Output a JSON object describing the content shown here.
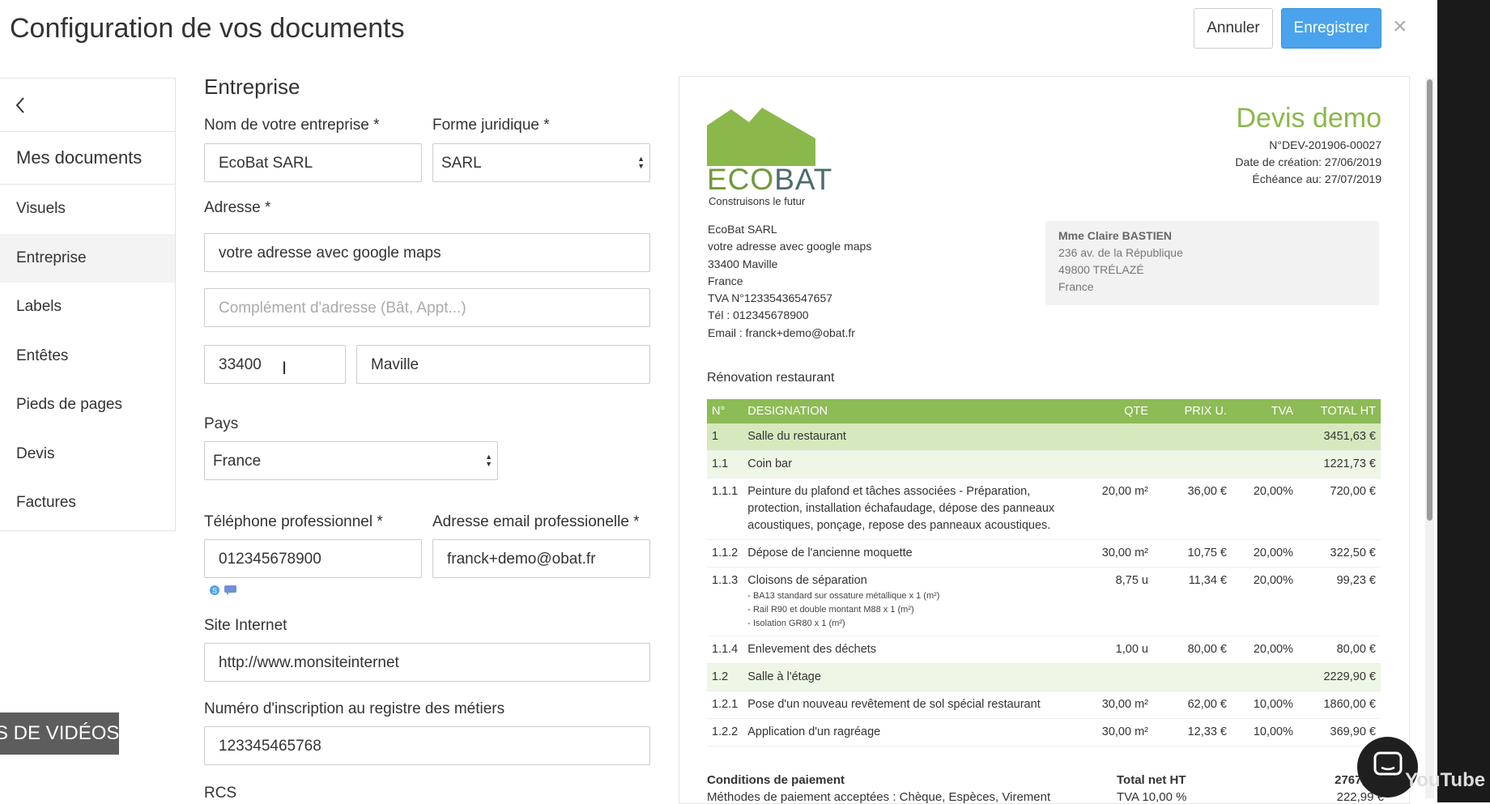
{
  "header": {
    "title": "Configuration de vos documents",
    "cancel_label": "Annuler",
    "save_label": "Enregistrer",
    "close_glyph": "×"
  },
  "sidebar": {
    "heading": "Mes documents",
    "items": [
      {
        "label": "Visuels"
      },
      {
        "label": "Entreprise"
      },
      {
        "label": "Labels"
      },
      {
        "label": "Entêtes"
      },
      {
        "label": "Pieds de pages"
      },
      {
        "label": "Devis"
      },
      {
        "label": "Factures"
      }
    ]
  },
  "form": {
    "section_title": "Entreprise",
    "company_name_label": "Nom de votre entreprise *",
    "company_name_value": "EcoBat SARL",
    "legal_form_label": "Forme juridique *",
    "legal_form_value": "SARL",
    "address_label": "Adresse *",
    "address_value": "votre adresse avec google maps",
    "address2_placeholder": "Complément d'adresse (Bât, Appt...)",
    "zip_value": "33400",
    "city_value": "Maville",
    "country_label": "Pays",
    "country_value": "France",
    "phone_label": "Téléphone professionnel *",
    "phone_value": "012345678900",
    "email_label": "Adresse email professionelle *",
    "email_value": "franck+demo@obat.fr",
    "website_label": "Site Internet",
    "website_value": "http://www.monsiteinternet",
    "registry_label": "Numéro d'inscription au registre des métiers",
    "registry_value": "123345465768",
    "rcs_label": "RCS"
  },
  "preview": {
    "logo_word_prefix": "ECO",
    "logo_word_suffix": "BAT",
    "logo_tagline": "Construisons le futur",
    "doc_title": "Devis demo",
    "doc_number": "N°DEV-201906-00027",
    "created": "Date de création: 27/06/2019",
    "due": "Échéance au: 27/07/2019",
    "sender": [
      "EcoBat SARL",
      "votre adresse avec google maps",
      "33400 Maville",
      "France",
      "TVA N°12335436547657",
      "Tél : 012345678900",
      "Email : franck+demo@obat.fr"
    ],
    "client": [
      "Mme Claire BASTIEN",
      "236 av. de la République",
      "49800 TRÉLAZÉ",
      "France"
    ],
    "project": "Rénovation restaurant",
    "columns": [
      "N°",
      "DESIGNATION",
      "QTE",
      "PRIX U.",
      "TVA",
      "TOTAL HT"
    ],
    "rows": [
      {
        "n": "1",
        "d": "Salle du restaurant",
        "q": "",
        "p": "",
        "t": "",
        "tot": "3451,63 €",
        "level": 1
      },
      {
        "n": "1.1",
        "d": "Coin bar",
        "q": "",
        "p": "",
        "t": "",
        "tot": "1221,73 €",
        "level": 2
      },
      {
        "n": "1.1.1",
        "d": "Peinture du plafond et tâches associées - Préparation, protection, installation échafaudage, dépose des panneaux acoustiques, ponçage, repose des panneaux acoustiques.",
        "q": "20,00 m²",
        "p": "36,00 €",
        "t": "20,00%",
        "tot": "720,00 €",
        "level": 3
      },
      {
        "n": "1.1.2",
        "d": "Dépose de l'ancienne moquette",
        "q": "30,00 m²",
        "p": "10,75 €",
        "t": "20,00%",
        "tot": "322,50 €",
        "level": 3
      },
      {
        "n": "1.1.3",
        "d": "Cloisons de séparation",
        "q": "8,75 u",
        "p": "11,34 €",
        "t": "20,00%",
        "tot": "99,23 €",
        "level": 3,
        "subs": [
          "- BA13 standard sur ossature métallique x 1 (m²)",
          "- Rail R90 et double montant M88 x 1 (m²)",
          "- Isolation GR80 x 1 (m²)"
        ]
      },
      {
        "n": "1.1.4",
        "d": "Enlevement des déchets",
        "q": "1,00 u",
        "p": "80,00 €",
        "t": "20,00%",
        "tot": "80,00 €",
        "level": 3
      },
      {
        "n": "1.2",
        "d": "Salle à l'étage",
        "q": "",
        "p": "",
        "t": "",
        "tot": "2229,90 €",
        "level": 2
      },
      {
        "n": "1.2.1",
        "d": "Pose d'un nouveau revêtement de sol spécial restaurant",
        "q": "30,00 m²",
        "p": "62,00 €",
        "t": "10,00%",
        "tot": "1860,00 €",
        "level": 3
      },
      {
        "n": "1.2.2",
        "d": "Application d'un ragréage",
        "q": "30,00 m²",
        "p": "12,33 €",
        "t": "10,00%",
        "tot": "369,90 €",
        "level": 3
      }
    ],
    "payment_title": "Conditions de paiement",
    "payment_methods": "Méthodes de paiement acceptées : Chèque, Espèces, Virement",
    "total_net_label": "Total net HT",
    "total_net_value": "2767,2…",
    "tva_label": "TVA 10,00 %",
    "tva_value": "222,99 €"
  },
  "overlay": {
    "video_banner": "S DE VIDÉOS",
    "youtube": "YouTube"
  },
  "colors": {
    "accent": "#4aa3ec",
    "brand_green": "#8dbb55"
  }
}
